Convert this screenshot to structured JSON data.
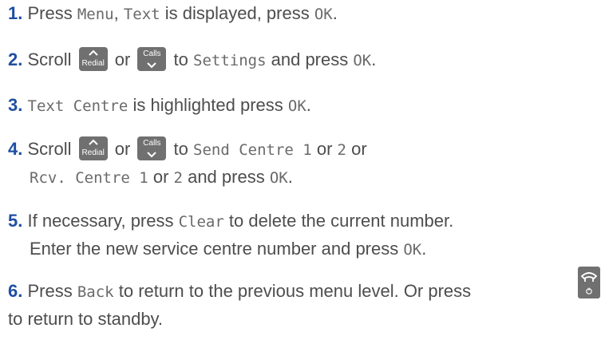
{
  "keys": {
    "up_label": "Redial",
    "down_label": "Calls"
  },
  "steps": [
    {
      "num": "1",
      "parts": [
        "Press ",
        "Menu",
        ", ",
        "Text",
        " is displayed, press ",
        "OK",
        "."
      ]
    },
    {
      "num": "2",
      "parts": [
        "Scroll ",
        " or ",
        " to ",
        "Settings",
        " and press ",
        "OK",
        "."
      ]
    },
    {
      "num": "3",
      "parts": [
        "Text Centre",
        " is highlighted press ",
        "OK",
        "."
      ]
    },
    {
      "num": "4",
      "parts": [
        "Scroll ",
        " or ",
        " to ",
        "Send Centre 1",
        " or ",
        "2",
        " or"
      ],
      "line2": [
        "Rcv. Centre 1",
        " or ",
        "2",
        " and press ",
        "OK",
        "."
      ]
    },
    {
      "num": "5",
      "parts": [
        "If necessary, press ",
        "Clear",
        " to delete the current number."
      ],
      "line2": [
        "Enter the new service centre number and press ",
        "OK",
        "."
      ]
    },
    {
      "num": "6",
      "parts": [
        "Press ",
        "Back",
        " to return to the previous menu level. Or press"
      ],
      "line2": [
        "to return to standby."
      ]
    }
  ]
}
